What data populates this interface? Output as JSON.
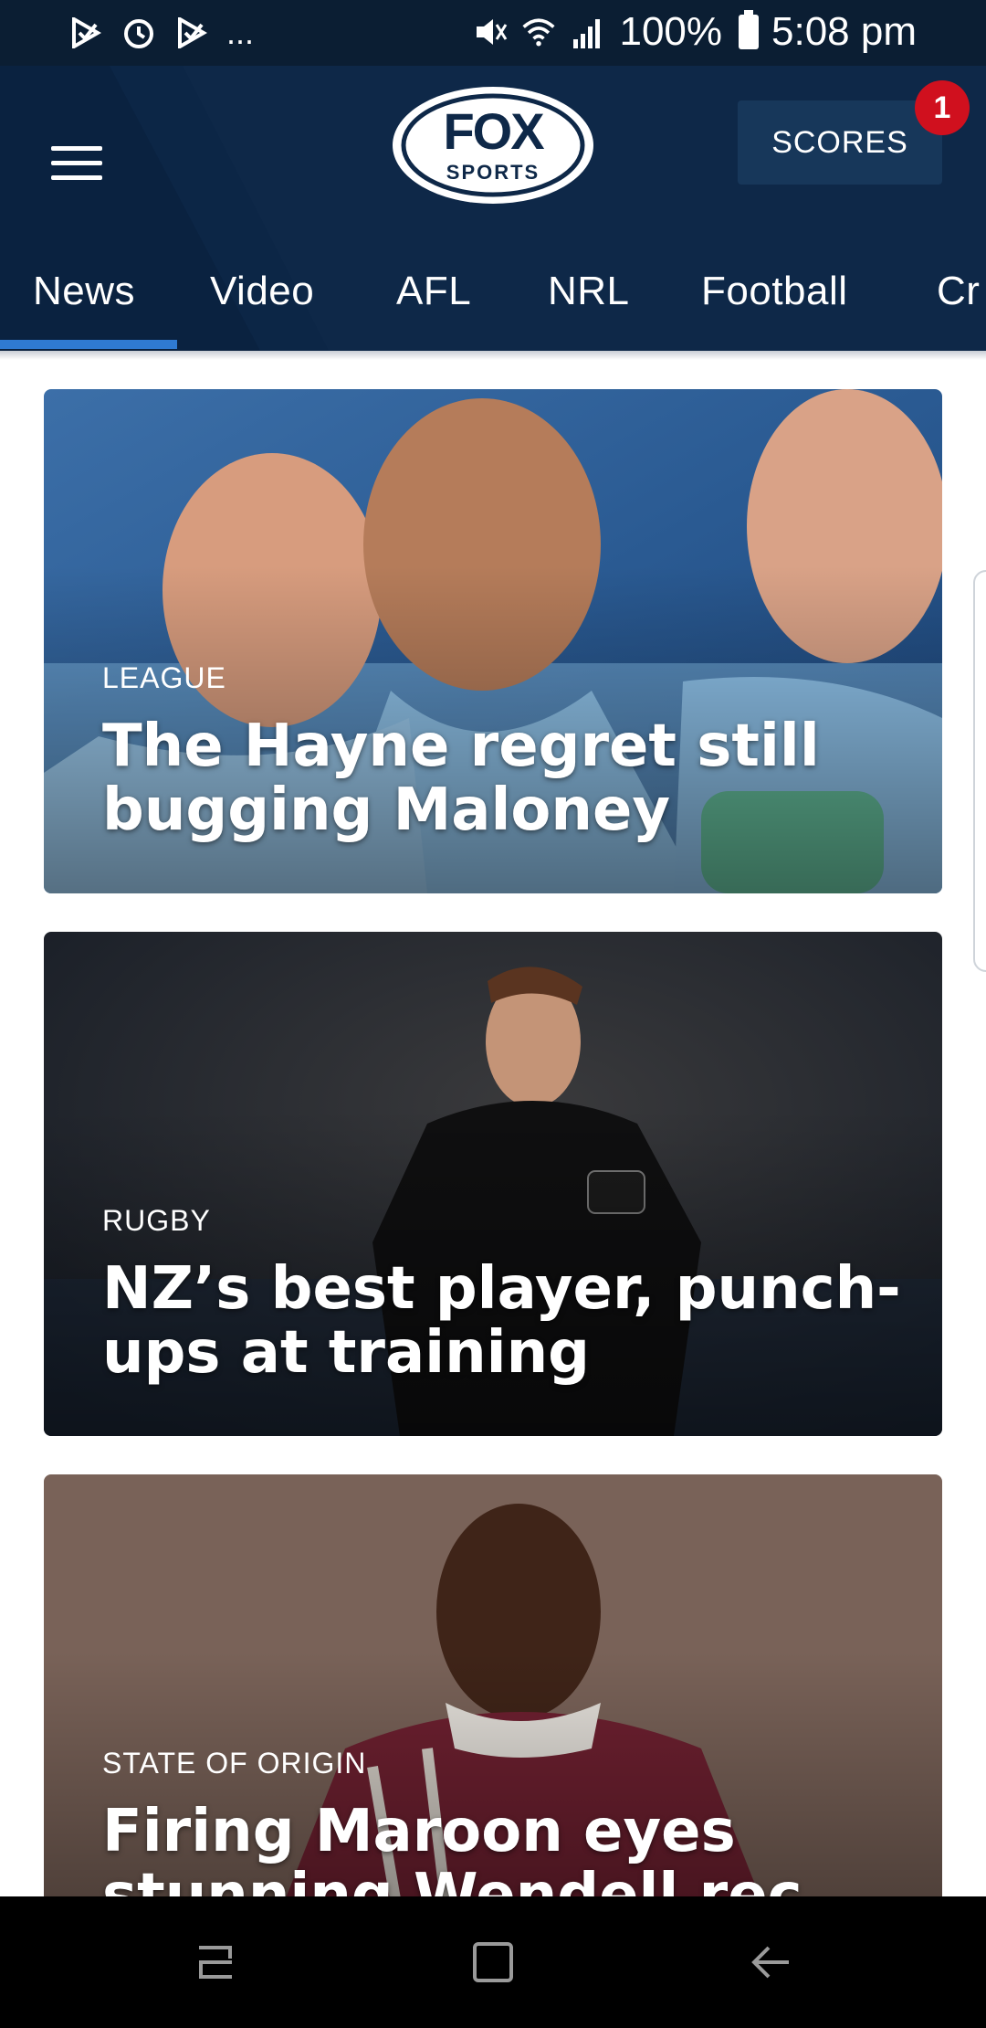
{
  "status_bar": {
    "left_icons": [
      "play-store-icon",
      "alarm-icon",
      "play-store-icon",
      "more-notifications-icon"
    ],
    "more_text": "...",
    "right_icons": [
      "mute-icon",
      "wifi-icon",
      "signal-icon"
    ],
    "battery_text": "100%",
    "time": "5:08 pm"
  },
  "header": {
    "logo_text": "FOX",
    "logo_sub": "SPORTS",
    "scores_label": "SCORES",
    "scores_badge": "1",
    "colors": {
      "header_bg": "#0e2848",
      "badge": "#d0101e",
      "tab_indicator": "#2f7ad1"
    }
  },
  "tabs": [
    {
      "label": "News",
      "active": true
    },
    {
      "label": "Video"
    },
    {
      "label": "AFL"
    },
    {
      "label": "NRL"
    },
    {
      "label": "Football"
    },
    {
      "label": "Cr"
    }
  ],
  "articles": [
    {
      "category": "LEAGUE",
      "title": "The Hayne regret still bugging Maloney"
    },
    {
      "category": "RUGBY",
      "title": "NZ’s best player, punch-ups at training"
    },
    {
      "category": "STATE OF ORIGIN",
      "title": "Firing Maroon eyes stunning Wendell rec"
    }
  ],
  "nav_bar": {
    "buttons": [
      "recent-apps-icon",
      "home-icon",
      "back-icon"
    ]
  }
}
